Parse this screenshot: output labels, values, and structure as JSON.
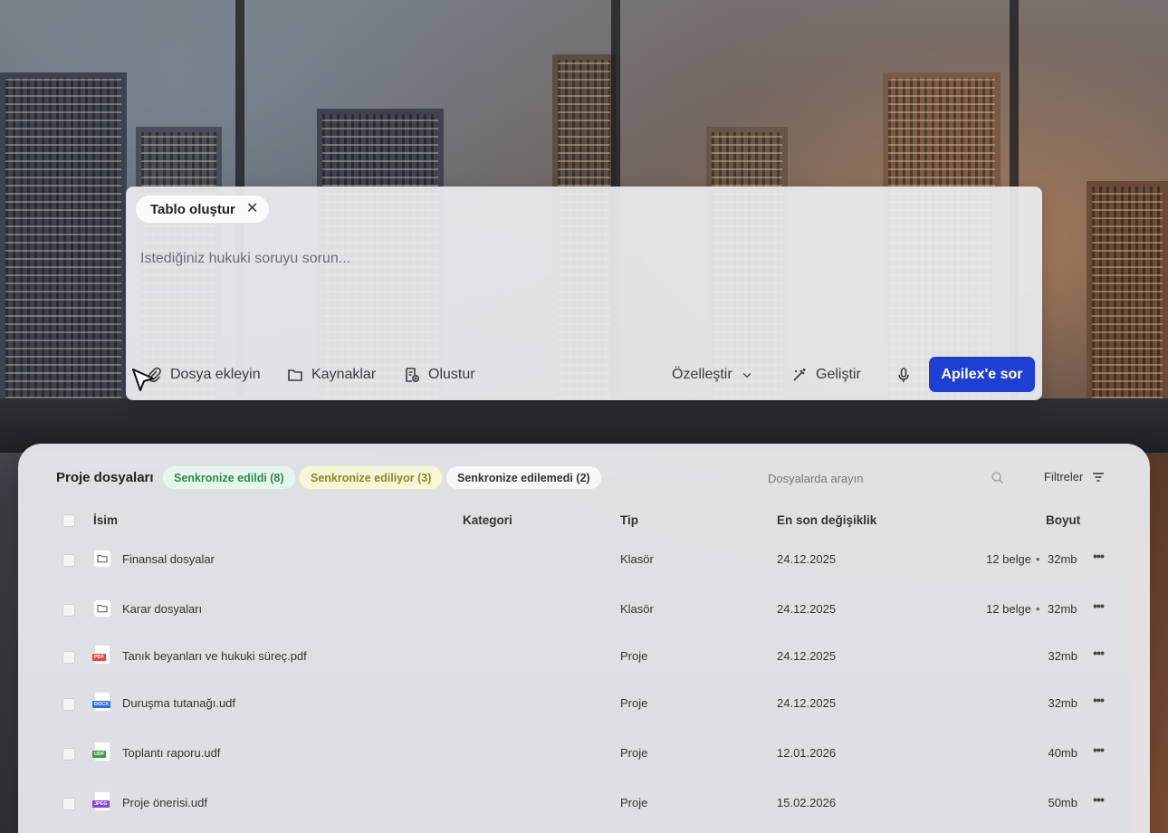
{
  "prompt": {
    "chip_label": "Tablo oluştur",
    "chip_close": "✕",
    "placeholder": "İstediğiniz hukuki soruyu sorun...",
    "toolbar": {
      "attach": "Dosya ekleyin",
      "sources": "Kaynaklar",
      "create": "Olustur",
      "customize": "Özelleştir",
      "improve": "Geliştir",
      "ask": "Apilex'e sor"
    }
  },
  "files": {
    "title": "Proje dosyaları",
    "badges": {
      "synced": "Senkronize edildi (8)",
      "syncing": "Senkronize ediliyor (3)",
      "not_synced": "Senkronize edilemedi (2)"
    },
    "search_placeholder": "Dosyalarda arayın",
    "filters_label": "Filtreler",
    "columns": {
      "name": "İsim",
      "category": "Kategori",
      "type": "Tip",
      "modified": "En son değişiklik",
      "size": "Boyut"
    },
    "rows": [
      {
        "name": "Finansal dosyalar",
        "type": "Klasör",
        "date": "24.12.2025",
        "count": "12 belge",
        "size": "32mb",
        "icon": "folder-icon"
      },
      {
        "name": "Karar dosyaları",
        "type": "Klasör",
        "date": "24.12.2025",
        "count": "12 belge",
        "size": "32mb",
        "icon": "folder-icon"
      },
      {
        "name": "Tanık beyanları ve hukuki süreç.pdf",
        "type": "Proje",
        "date": "24.12.2025",
        "size": "32mb",
        "icon": "pdf-icon",
        "tag": "PDF",
        "tag_color": "#e5483b"
      },
      {
        "name": "Duruşma tutanağı.udf",
        "type": "Proje",
        "date": "24.12.2025",
        "size": "32mb",
        "icon": "docx-icon",
        "tag": "DOCX",
        "tag_color": "#2f6de0"
      },
      {
        "name": "Toplantı raporu.udf",
        "type": "Proje",
        "date": "12.01.2026",
        "size": "40mb",
        "icon": "udf-icon",
        "tag": "UDF",
        "tag_color": "#3f9a3a"
      },
      {
        "name": "Proje önerisi.udf",
        "type": "Proje",
        "date": "15.02.2026",
        "size": "50mb",
        "icon": "jpeg-icon",
        "tag": "JPEG",
        "tag_color": "#8a3fd6"
      }
    ],
    "dot": "•",
    "more": "•••"
  },
  "colors": {
    "accent": "#1d3fd4",
    "synced": "#2a8a4c",
    "syncing": "#8b8a1a"
  }
}
